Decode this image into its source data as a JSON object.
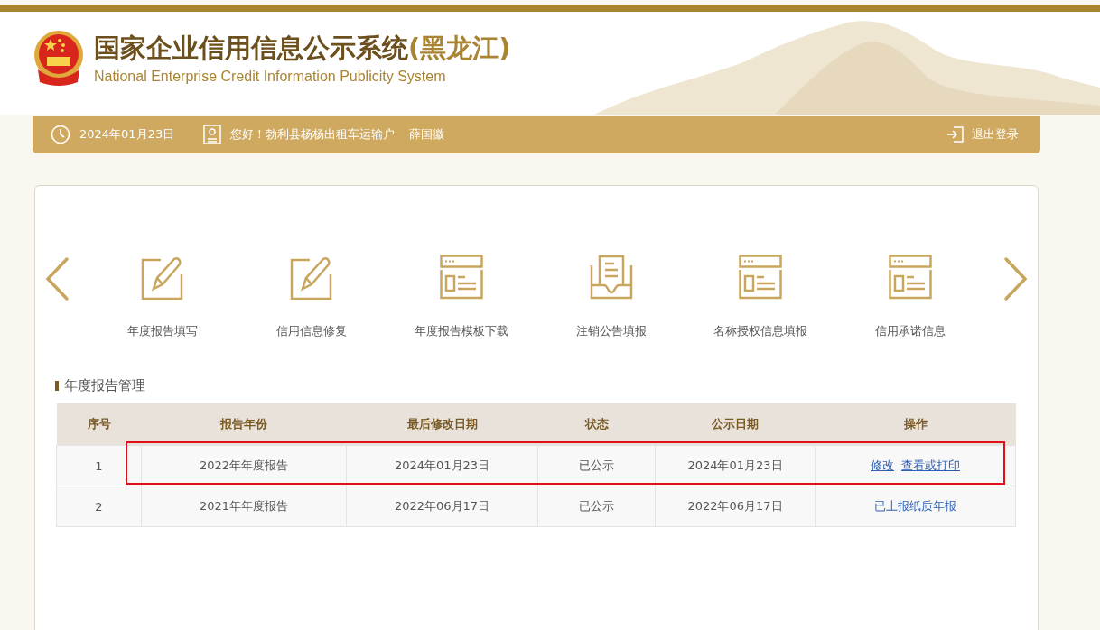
{
  "header": {
    "title": "国家企业信用信息公示系统",
    "region": "(黑龙江)",
    "subtitle": "National Enterprise Credit Information Publicity System"
  },
  "user_bar": {
    "date": "2024年01月23日",
    "greeting": "您好！勃利县杨杨出租车运输户",
    "name": "薛国徽",
    "logout": "退出登录"
  },
  "services": [
    {
      "label": "年度报告填写",
      "kind": "edit"
    },
    {
      "label": "信用信息修复",
      "kind": "edit"
    },
    {
      "label": "年度报告模板下载",
      "kind": "page"
    },
    {
      "label": "注销公告填报",
      "kind": "tray"
    },
    {
      "label": "名称授权信息填报",
      "kind": "page"
    },
    {
      "label": "信用承诺信息",
      "kind": "page"
    }
  ],
  "section_title": "年度报告管理",
  "table": {
    "columns": [
      "序号",
      "报告年份",
      "最后修改日期",
      "状态",
      "公示日期",
      "操作"
    ],
    "rows": [
      {
        "cells": [
          "1",
          "2022年年度报告",
          "2024年01月23日",
          "已公示",
          "2024年01月23日"
        ],
        "actions": [
          {
            "label": "修改",
            "underlined": true
          },
          {
            "label": "查看或打印",
            "underlined": true
          }
        ],
        "highlighted": true
      },
      {
        "cells": [
          "2",
          "2021年年度报告",
          "2022年06月17日",
          "已公示",
          "2022年06月17日"
        ],
        "actions": [
          {
            "label": "已上报纸质年报",
            "underlined": false
          }
        ],
        "highlighted": false
      }
    ]
  }
}
